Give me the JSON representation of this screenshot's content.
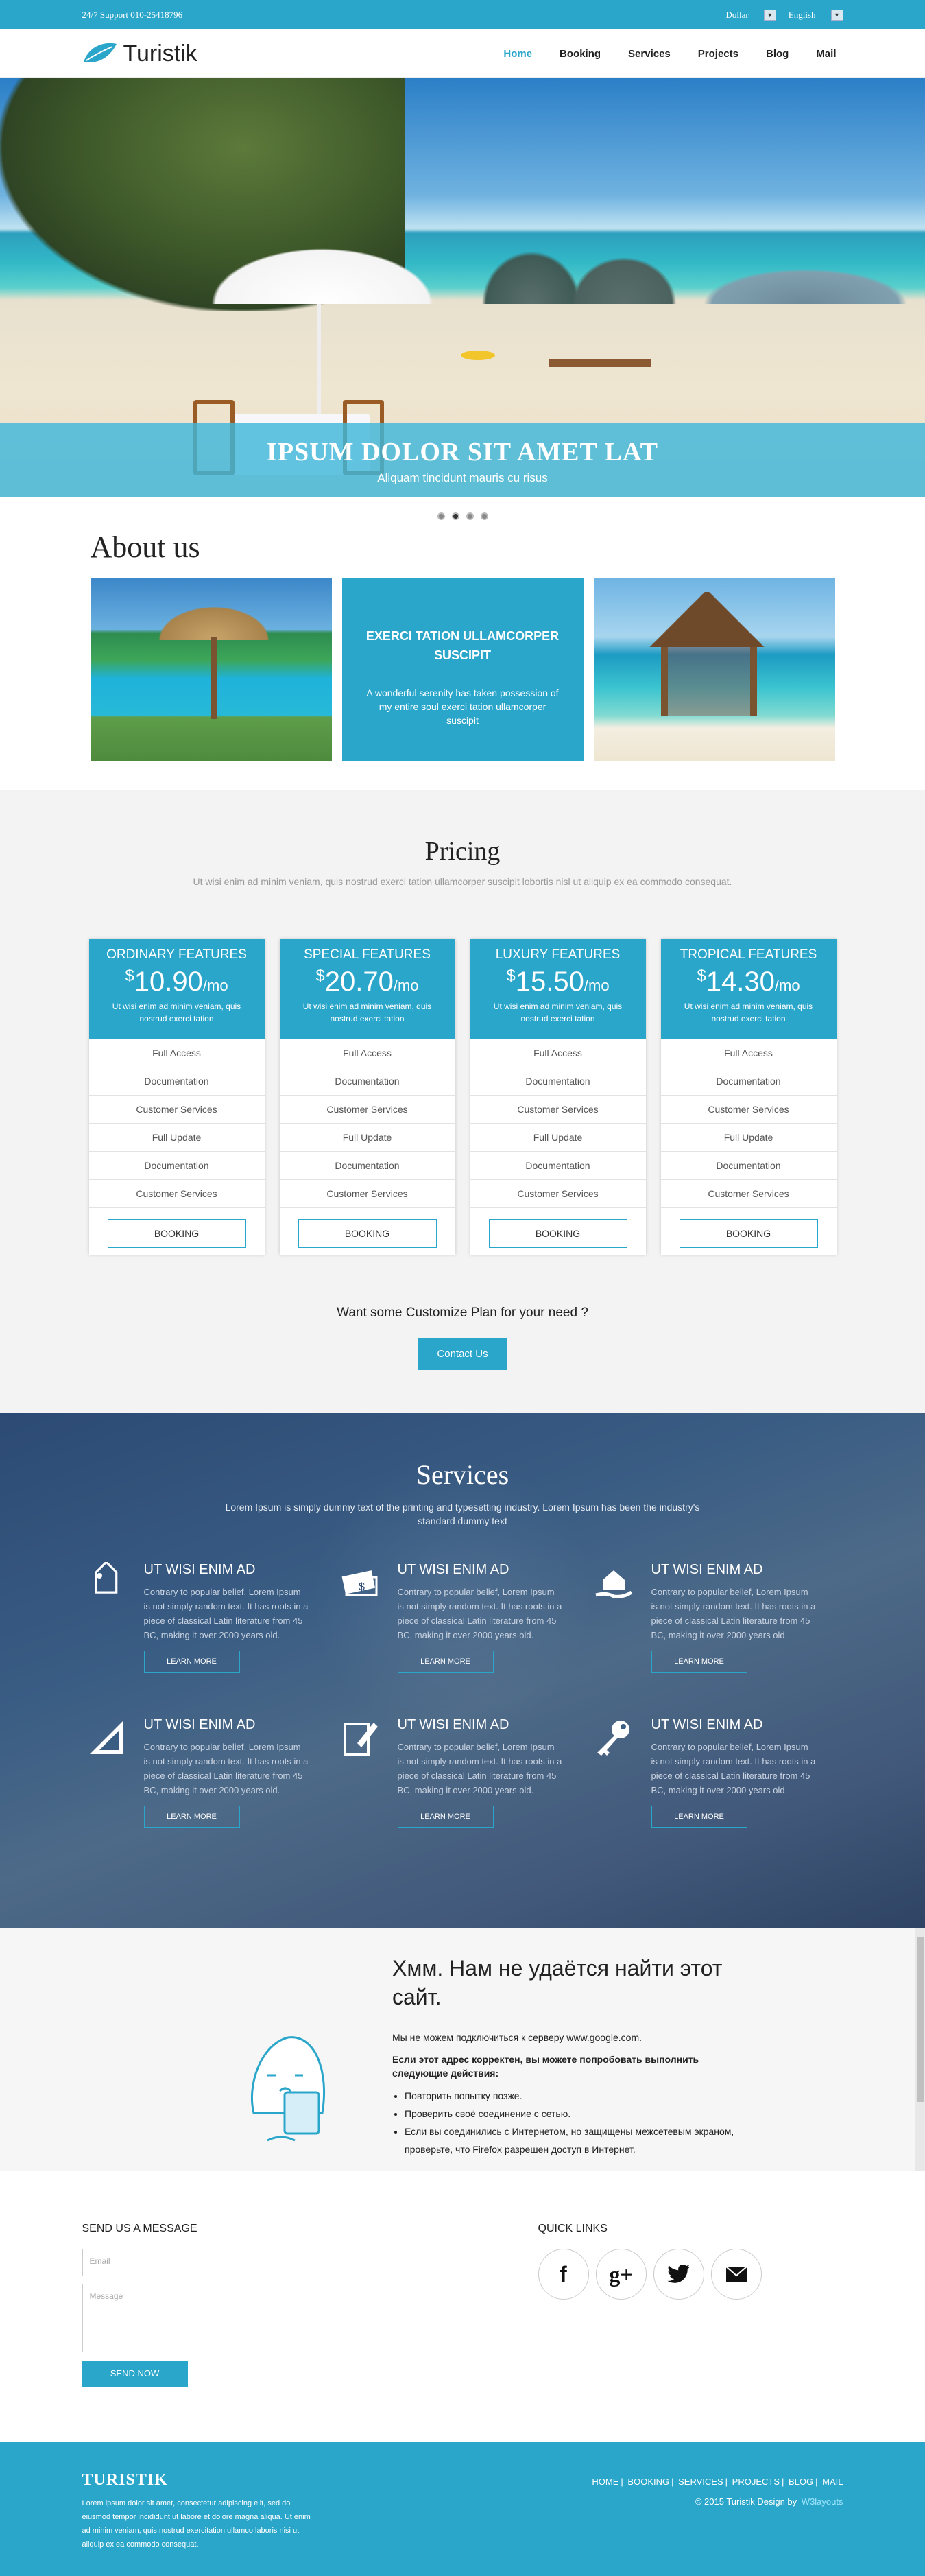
{
  "topbar": {
    "support": "24/7 Support 010-25418796",
    "currency": "Dollar",
    "language": "English"
  },
  "header": {
    "logo": "Turistik",
    "nav": [
      "Home",
      "Booking",
      "Services",
      "Projects",
      "Blog",
      "Mail"
    ]
  },
  "hero": {
    "title": "IPSUM DOLOR SIT AMET LAT",
    "subtitle": "Aliquam tincidunt mauris cu risus",
    "slides": 4,
    "active_slide": 2
  },
  "about": {
    "title": "About us",
    "box_title": "EXERCI TATION ULLAMCORPER SUSCIPIT",
    "box_text": "A wonderful serenity has taken possession of my entire soul exerci tation ullamcorper suscipit"
  },
  "pricing": {
    "title": "Pricing",
    "subtitle": "Ut wisi enim ad minim veniam, quis nostrud exerci tation ullamcorper suscipit lobortis nisl ut aliquip ex ea commodo consequat.",
    "plans": [
      {
        "name": "ORDINARY FEATURES",
        "currency": "$",
        "price": "10.90",
        "per": "/mo",
        "desc": "Ut wisi enim ad minim veniam, quis nostrud exerci tation",
        "features": [
          "Full Access",
          "Documentation",
          "Customer Services",
          "Full Update",
          "Documentation",
          "Customer Services"
        ],
        "button": "BOOKING"
      },
      {
        "name": "SPECIAL FEATURES",
        "currency": "$",
        "price": "20.70",
        "per": "/mo",
        "desc": "Ut wisi enim ad minim veniam, quis nostrud exerci tation",
        "features": [
          "Full Access",
          "Documentation",
          "Customer Services",
          "Full Update",
          "Documentation",
          "Customer Services"
        ],
        "button": "BOOKING"
      },
      {
        "name": "LUXURY FEATURES",
        "currency": "$",
        "price": "15.50",
        "per": "/mo",
        "desc": "Ut wisi enim ad minim veniam, quis nostrud exerci tation",
        "features": [
          "Full Access",
          "Documentation",
          "Customer Services",
          "Full Update",
          "Documentation",
          "Customer Services"
        ],
        "button": "BOOKING"
      },
      {
        "name": "TROPICAL FEATURES",
        "currency": "$",
        "price": "14.30",
        "per": "/mo",
        "desc": "Ut wisi enim ad minim veniam, quis nostrud exerci tation",
        "features": [
          "Full Access",
          "Documentation",
          "Customer Services",
          "Full Update",
          "Documentation",
          "Customer Services"
        ],
        "button": "BOOKING"
      }
    ],
    "custom_question": "Want some Customize Plan for your need ?",
    "contact_button": "Contact Us"
  },
  "services": {
    "title": "Services",
    "subtitle": "Lorem Ipsum is simply dummy text of the printing and typesetting industry. Lorem Ipsum has been the industry's standard dummy text",
    "items": [
      {
        "icon": "tag-icon",
        "title": "UT WISI ENIM AD",
        "text": "Contrary to popular belief, Lorem Ipsum is not simply random text. It has roots in a piece of classical Latin literature from 45 BC, making it over 2000 years old.",
        "button": "LEARN MORE"
      },
      {
        "icon": "money-icon",
        "title": "UT WISI ENIM AD",
        "text": "Contrary to popular belief, Lorem Ipsum is not simply random text. It has roots in a piece of classical Latin literature from 45 BC, making it over 2000 years old.",
        "button": "LEARN MORE"
      },
      {
        "icon": "house-hand-icon",
        "title": "UT WISI ENIM AD",
        "text": "Contrary to popular belief, Lorem Ipsum is not simply random text. It has roots in a piece of classical Latin literature from 45 BC, making it over 2000 years old.",
        "button": "LEARN MORE"
      },
      {
        "icon": "ruler-icon",
        "title": "UT WISI ENIM AD",
        "text": "Contrary to popular belief, Lorem Ipsum is not simply random text. It has roots in a piece of classical Latin literature from 45 BC, making it over 2000 years old.",
        "button": "LEARN MORE"
      },
      {
        "icon": "document-pen-icon",
        "title": "UT WISI ENIM AD",
        "text": "Contrary to popular belief, Lorem Ipsum is not simply random text. It has roots in a piece of classical Latin literature from 45 BC, making it over 2000 years old.",
        "button": "LEARN MORE"
      },
      {
        "icon": "key-icon",
        "title": "UT WISI ENIM AD",
        "text": "Contrary to popular belief, Lorem Ipsum is not simply random text. It has roots in a piece of classical Latin literature from 45 BC, making it over 2000 years old.",
        "button": "LEARN MORE"
      }
    ]
  },
  "error": {
    "title": "Хмм. Нам не удаётся найти этот сайт.",
    "line": "Мы не можем подключиться к серверу www.google.com.",
    "bold": "Если этот адрес корректен, вы можете попробовать выполнить следующие действия:",
    "tips": [
      "Повторить попытку позже.",
      "Проверить своё соединение с сетью.",
      "Если вы соединились с Интернетом, но защищены межсетевым экраном, проверьте, что Firefox разрешен доступ в Интернет."
    ]
  },
  "contact": {
    "title": "SEND US A MESSAGE",
    "email_placeholder": "Email",
    "message_placeholder": "Message",
    "send": "SEND NOW",
    "quick_links": "QUICK LINKS",
    "socials": [
      "facebook-icon",
      "google-plus-icon",
      "twitter-icon",
      "mail-icon"
    ]
  },
  "footer": {
    "brand": "TURISTIK",
    "text": "Lorem ipsum dolor sit amet, consectetur adipiscing elit, sed do eiusmod tempor incididunt ut labore et dolore magna aliqua. Ut enim ad minim veniam, quis nostrud exercitation ullamco laboris nisi ut aliquip ex ea commodo consequat.",
    "links": [
      "HOME",
      "BOOKING",
      "SERVICES",
      "PROJECTS",
      "BLOG",
      "MAIL"
    ],
    "copy": "© 2015 Turistik Design by",
    "designer": "W3layouts"
  },
  "colors": {
    "accent": "#2ba6cb",
    "services_bg": "#3a5d84"
  }
}
